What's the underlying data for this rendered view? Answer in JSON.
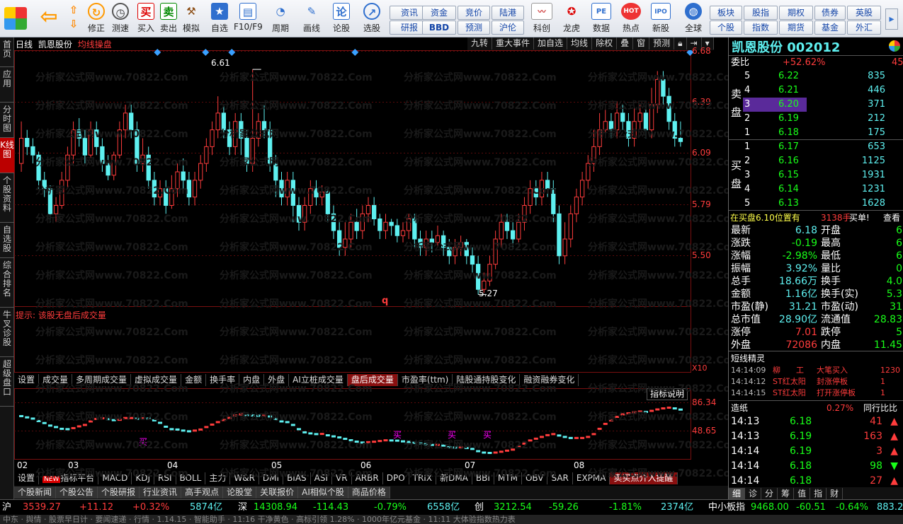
{
  "toolbar": {
    "buttons": [
      {
        "label": "修正",
        "icon": "arrow-up-down-icon"
      },
      {
        "label": "测速",
        "icon": "clock-icon"
      },
      {
        "label": "买入",
        "char": "买"
      },
      {
        "label": "卖出",
        "char": "卖"
      },
      {
        "label": "模拟",
        "icon": "hammer-icon"
      },
      {
        "label": "自选"
      },
      {
        "label": "F10/F9"
      },
      {
        "label": "周期"
      },
      {
        "label": "画线"
      },
      {
        "label": "论股",
        "char": "论"
      },
      {
        "label": "选股"
      },
      {
        "label": "科创"
      },
      {
        "label": "龙虎"
      },
      {
        "label": "数据",
        "char": "PE"
      },
      {
        "label": "热点",
        "char": "HOT"
      },
      {
        "label": "新股",
        "char": "IPO"
      },
      {
        "label": "全球"
      }
    ],
    "grid_left": [
      "资讯",
      "资金",
      "竞价",
      "陆港",
      "研报",
      "BBD",
      "预测",
      "沪伦"
    ],
    "grid_right": [
      "板块",
      "股指",
      "期权",
      "债券",
      "英股",
      "个股",
      "指数",
      "期货",
      "基金",
      "外汇"
    ]
  },
  "leftnav": [
    "首页",
    "应用",
    "分时图",
    "K线图",
    "个股资料",
    "自选股",
    "综合排名",
    "牛叉诊股",
    "超级盘口"
  ],
  "chart": {
    "period_label": "日线",
    "stock_name": "凯恩股份",
    "indicator_name": "均线操盘",
    "top_buttons": [
      "九转",
      "重大事件",
      "加自选",
      "均线",
      "除权",
      "叠",
      "窗",
      "预测"
    ],
    "price_axis": [
      "6.68",
      "6.39",
      "6.09",
      "5.79",
      "5.50"
    ],
    "high_mark": "6.61",
    "low_mark": "5.27",
    "q_mark": "q",
    "hint": "提示: 该股无盘后成交量",
    "x10": "X10",
    "watermark": "分析家公式网www.70822.Com",
    "tabs": [
      "设置",
      "成交量",
      "多周期成交量",
      "虚拟成交量",
      "金额",
      "换手率",
      "内盘",
      "外盘",
      "AI立桩成交量",
      "盘后成交量",
      "市盈率(ttm)",
      "陆股通持股变化",
      "融资融券变化"
    ],
    "active_tab": "盘后成交量",
    "indicator_explain": "指标说明",
    "osc_axis": [
      "86.34",
      "48.65"
    ],
    "buy_label": "买",
    "month_axis": [
      "02",
      "03",
      "04",
      "05",
      "06",
      "07",
      "08"
    ],
    "bottom_tabs": [
      "设置",
      "指标平台",
      "MACD",
      "KDJ",
      "RSI",
      "BOLL",
      "主力",
      "W&R",
      "DMI",
      "BIAS",
      "ASI",
      "VR",
      "ARBR",
      "DPO",
      "TRIX",
      "新DMA",
      "BBI",
      "MTM",
      "OBV",
      "SAR",
      "EXPMA",
      "卖买点介入提醒"
    ],
    "new_badge": "NEW",
    "news_tabs": [
      "个股新闻",
      "个股公告",
      "个股研报",
      "行业资讯",
      "高手观点",
      "论股堂",
      "关联报价",
      "AI相似个股",
      "商品价格"
    ]
  },
  "chart_data": {
    "type": "candlestick",
    "title": "凯恩股份 日线",
    "ylim": [
      5.2,
      6.72
    ],
    "annotations": {
      "high": 6.61,
      "low": 5.27
    },
    "months": [
      "02",
      "03",
      "04",
      "05",
      "06",
      "07",
      "08"
    ],
    "candles": [
      [
        6.05,
        6.2,
        6.3,
        6.0
      ],
      [
        6.2,
        6.15,
        6.25,
        6.1
      ],
      [
        6.15,
        6.1,
        6.2,
        6.05
      ],
      [
        6.1,
        5.95,
        6.12,
        5.9
      ],
      [
        5.95,
        5.9,
        6.0,
        5.85
      ],
      [
        5.9,
        5.75,
        5.92,
        5.7
      ],
      [
        5.75,
        5.8,
        5.85,
        5.7
      ],
      [
        5.8,
        5.95,
        6.0,
        5.78
      ],
      [
        5.95,
        6.1,
        6.15,
        5.9
      ],
      [
        6.1,
        6.25,
        6.3,
        6.05
      ],
      [
        6.25,
        6.2,
        6.32,
        6.15
      ],
      [
        6.2,
        6.1,
        6.25,
        6.05
      ],
      [
        6.1,
        6.25,
        6.3,
        6.08
      ],
      [
        6.25,
        6.15,
        6.3,
        6.1
      ],
      [
        6.15,
        6.05,
        6.2,
        6.0
      ],
      [
        6.05,
        5.98,
        6.1,
        5.95
      ],
      [
        5.98,
        6.1,
        6.12,
        5.95
      ],
      [
        6.1,
        6.25,
        6.3,
        6.08
      ],
      [
        6.25,
        6.35,
        6.4,
        6.2
      ],
      [
        6.35,
        6.25,
        6.4,
        6.2
      ],
      [
        6.25,
        6.05,
        6.3,
        6.0
      ],
      [
        6.05,
        6.1,
        6.2,
        6.0
      ],
      [
        6.1,
        5.95,
        6.15,
        5.9
      ],
      [
        5.95,
        5.85,
        6.0,
        5.8
      ],
      [
        5.85,
        5.9,
        5.95,
        5.8
      ],
      [
        5.9,
        5.8,
        5.95,
        5.75
      ],
      [
        5.8,
        5.9,
        5.98,
        5.78
      ],
      [
        5.9,
        6.0,
        6.05,
        5.85
      ],
      [
        6.0,
        5.95,
        6.08,
        5.9
      ],
      [
        5.95,
        5.85,
        6.0,
        5.8
      ],
      [
        5.85,
        5.95,
        6.0,
        5.8
      ],
      [
        5.95,
        6.05,
        6.1,
        5.9
      ],
      [
        6.05,
        6.15,
        6.2,
        6.0
      ],
      [
        6.15,
        6.25,
        6.3,
        6.1
      ],
      [
        6.25,
        6.35,
        6.45,
        6.2
      ],
      [
        6.35,
        6.25,
        6.4,
        6.2
      ],
      [
        6.25,
        6.15,
        6.3,
        6.1
      ],
      [
        6.15,
        6.3,
        6.35,
        6.1
      ],
      [
        6.3,
        6.2,
        6.35,
        6.1
      ],
      [
        6.2,
        6.05,
        6.25,
        6.0
      ],
      [
        6.05,
        6.2,
        6.61,
        6.0
      ],
      [
        6.2,
        6.3,
        6.35,
        6.15
      ],
      [
        6.3,
        6.25,
        6.4,
        6.2
      ],
      [
        6.25,
        6.05,
        6.3,
        6.0
      ],
      [
        6.05,
        5.95,
        6.1,
        5.85
      ],
      [
        5.95,
        5.85,
        6.0,
        5.8
      ],
      [
        5.85,
        5.95,
        6.0,
        5.8
      ],
      [
        5.95,
        5.8,
        6.0,
        5.7
      ],
      [
        5.8,
        5.7,
        5.85,
        5.65
      ],
      [
        5.7,
        5.8,
        5.85,
        5.65
      ],
      [
        5.8,
        5.9,
        5.95,
        5.75
      ],
      [
        5.9,
        5.85,
        5.95,
        5.8
      ],
      [
        5.85,
        5.88,
        5.92,
        5.8
      ],
      [
        5.88,
        5.75,
        5.9,
        5.7
      ],
      [
        5.75,
        5.65,
        5.8,
        5.6
      ],
      [
        5.65,
        5.55,
        5.7,
        5.5
      ],
      [
        5.55,
        5.6,
        5.7,
        5.5
      ],
      [
        5.6,
        5.7,
        5.75,
        5.55
      ],
      [
        5.7,
        5.65,
        5.78,
        5.6
      ],
      [
        5.65,
        5.75,
        5.8,
        5.6
      ],
      [
        5.75,
        5.8,
        5.85,
        5.7
      ],
      [
        5.8,
        5.72,
        5.85,
        5.68
      ],
      [
        5.72,
        5.65,
        5.75,
        5.6
      ],
      [
        5.65,
        5.7,
        5.75,
        5.6
      ],
      [
        5.7,
        5.68,
        5.72,
        5.62
      ],
      [
        5.68,
        5.62,
        5.72,
        5.58
      ],
      [
        5.62,
        5.65,
        5.7,
        5.58
      ],
      [
        5.65,
        5.72,
        5.75,
        5.6
      ],
      [
        5.72,
        5.6,
        5.75,
        5.55
      ],
      [
        5.6,
        5.55,
        5.65,
        5.5
      ],
      [
        5.55,
        5.6,
        5.65,
        5.5
      ],
      [
        5.6,
        5.58,
        5.65,
        5.52
      ],
      [
        5.58,
        5.62,
        5.68,
        5.55
      ],
      [
        5.62,
        5.55,
        5.65,
        5.5
      ],
      [
        5.55,
        5.5,
        5.6,
        5.45
      ],
      [
        5.5,
        5.55,
        5.6,
        5.45
      ],
      [
        5.55,
        5.58,
        5.62,
        5.5
      ],
      [
        5.58,
        5.5,
        5.6,
        5.45
      ],
      [
        5.5,
        5.45,
        5.55,
        5.4
      ],
      [
        5.45,
        5.3,
        5.5,
        5.27
      ],
      [
        5.3,
        5.35,
        5.4,
        5.28
      ],
      [
        5.35,
        5.45,
        5.5,
        5.32
      ],
      [
        5.45,
        5.6,
        5.65,
        5.42
      ],
      [
        5.6,
        5.7,
        5.75,
        5.55
      ],
      [
        5.7,
        5.65,
        5.75,
        5.6
      ],
      [
        5.65,
        5.6,
        5.7,
        5.55
      ],
      [
        5.6,
        5.7,
        5.75,
        5.58
      ],
      [
        5.7,
        5.8,
        5.85,
        5.65
      ],
      [
        5.8,
        5.9,
        5.95,
        5.75
      ],
      [
        5.9,
        5.85,
        5.95,
        5.8
      ],
      [
        5.85,
        5.95,
        6.0,
        5.8
      ],
      [
        5.95,
        5.9,
        6.0,
        5.85
      ],
      [
        5.9,
        5.75,
        5.95,
        5.7
      ],
      [
        5.75,
        5.5,
        5.8,
        5.45
      ],
      [
        5.5,
        5.6,
        5.7,
        5.45
      ],
      [
        5.6,
        5.75,
        5.8,
        5.55
      ],
      [
        5.75,
        5.85,
        5.9,
        5.7
      ],
      [
        5.85,
        5.95,
        6.0,
        5.8
      ],
      [
        5.95,
        6.05,
        6.1,
        5.9
      ],
      [
        6.05,
        6.15,
        6.25,
        6.0
      ],
      [
        6.15,
        6.25,
        6.35,
        6.1
      ],
      [
        6.25,
        6.3,
        6.4,
        6.2
      ],
      [
        6.3,
        6.25,
        6.35,
        6.2
      ],
      [
        6.25,
        6.35,
        6.42,
        6.2
      ],
      [
        6.35,
        6.3,
        6.4,
        6.25
      ],
      [
        6.3,
        6.2,
        6.35,
        6.15
      ],
      [
        6.2,
        6.3,
        6.38,
        6.15
      ],
      [
        6.3,
        6.35,
        6.4,
        6.25
      ],
      [
        6.35,
        6.25,
        6.4,
        6.2
      ],
      [
        6.25,
        6.4,
        6.5,
        6.2
      ],
      [
        6.4,
        6.55,
        6.6,
        6.35
      ],
      [
        6.55,
        6.45,
        6.6,
        6.4
      ],
      [
        6.45,
        6.3,
        6.5,
        6.25
      ],
      [
        6.3,
        6.2,
        6.35,
        6.15
      ],
      [
        6.2,
        6.18,
        6.3,
        6.15
      ]
    ]
  },
  "quote": {
    "title": "凯恩股份 002012",
    "weibi_label": "委比",
    "weibi_value": "+52.62%",
    "weibi_tail": "45",
    "sell_group_label": [
      "卖",
      "盘"
    ],
    "buy_group_label": [
      "买",
      "盘"
    ],
    "sell": [
      {
        "lvl": "5",
        "price": "6.22",
        "vol": "835"
      },
      {
        "lvl": "4",
        "price": "6.21",
        "vol": "446"
      },
      {
        "lvl": "3",
        "price": "6.20",
        "vol": "371"
      },
      {
        "lvl": "2",
        "price": "6.19",
        "vol": "212"
      },
      {
        "lvl": "1",
        "price": "6.18",
        "vol": "175"
      }
    ],
    "buy": [
      {
        "lvl": "1",
        "price": "6.17",
        "vol": "653"
      },
      {
        "lvl": "2",
        "price": "6.16",
        "vol": "1125"
      },
      {
        "lvl": "3",
        "price": "6.15",
        "vol": "1931"
      },
      {
        "lvl": "4",
        "price": "6.14",
        "vol": "1231"
      },
      {
        "lvl": "5",
        "price": "6.13",
        "vol": "1628"
      }
    ],
    "order_info": "在买盘6.10位置有",
    "order_qty": "3138手",
    "order_type": "买单!",
    "order_view": "查看",
    "stats": [
      {
        "k1": "最新",
        "v1": "6.18",
        "k2": "开盘",
        "v2": "6"
      },
      {
        "k1": "涨跌",
        "v1": "-0.19",
        "k2": "最高",
        "v2": "6"
      },
      {
        "k1": "涨幅",
        "v1": "-2.98%",
        "k2": "最低",
        "v2": "6"
      },
      {
        "k1": "振幅",
        "v1": "3.92%",
        "k2": "量比",
        "v2": "0"
      },
      {
        "k1": "总手",
        "v1": "18.66万",
        "k2": "换手",
        "v2": "4.0"
      },
      {
        "k1": "金额",
        "v1": "1.16亿",
        "k2": "换手(实)",
        "v2": "5.3"
      },
      {
        "k1": "市盈(静)",
        "v1": "31.21",
        "k2": "市盈(动)",
        "v2": "31"
      },
      {
        "k1": "总市值",
        "v1": "28.90亿",
        "k2": "流通值",
        "v2": "28.83"
      },
      {
        "k1": "涨停",
        "v1": "7.01",
        "k2": "跌停",
        "v2": "5"
      },
      {
        "k1": "外盘",
        "v1": "72086",
        "k2": "内盘",
        "v2": "11.45"
      }
    ],
    "sprite_title": "短线精灵",
    "sprite": [
      {
        "time": "14:14:09",
        "name": "柳　　工",
        "event": "大笔买入",
        "val": "1230"
      },
      {
        "time": "14:14:12",
        "name": "ST红太阳",
        "event": "封涨停板",
        "val": "1"
      },
      {
        "time": "14:14:15",
        "name": "ST红太阳",
        "event": "打开涨停板",
        "val": "1"
      }
    ],
    "deal_label": "造纸",
    "deal_pct": "0.27%",
    "deal_link": "同行比比",
    "ticks": [
      {
        "time": "14:13",
        "price": "6.18",
        "vol": "41",
        "dir": "up"
      },
      {
        "time": "14:13",
        "price": "6.19",
        "vol": "163",
        "dir": "up"
      },
      {
        "time": "14:14",
        "price": "6.19",
        "vol": "3",
        "dir": "up"
      },
      {
        "time": "14:14",
        "price": "6.18",
        "vol": "98",
        "dir": "down"
      },
      {
        "time": "14:14",
        "price": "6.18",
        "vol": "27",
        "dir": "up"
      }
    ],
    "bottom_tabs": [
      "细",
      "诊",
      "分",
      "筹",
      "值",
      "指",
      "财"
    ]
  },
  "status": {
    "sh_label": "沪",
    "sh_value": "3539.27",
    "sh_change": "+11.12",
    "sh_pct": "+0.32%",
    "sh_amount": "5874亿",
    "sz_label": "深",
    "sz_value": "14308.94",
    "sz_change": "-114.43",
    "sz_pct": "-0.79%",
    "sz_amount": "6558亿",
    "cy_label": "创",
    "cy_value": "3212.54",
    "cy_change": "-59.26",
    "cy_pct": "-1.81%",
    "cy_amount": "2374亿",
    "zx_label": "中小板指",
    "zx_value": "9468.00",
    "zx_change": "-60.51",
    "zx_pct": "-0.64%",
    "zx_amount": "883.2"
  },
  "newsbar": "中东 · 舆情 · 股票早日计 · 要闻速递 · 行情 · 1.14.15 · 智能助手 · 11:16 干净黄色 · 高标引领 1.28% · 1000年亿元基金 · 11:11 大体验指数热力表"
}
